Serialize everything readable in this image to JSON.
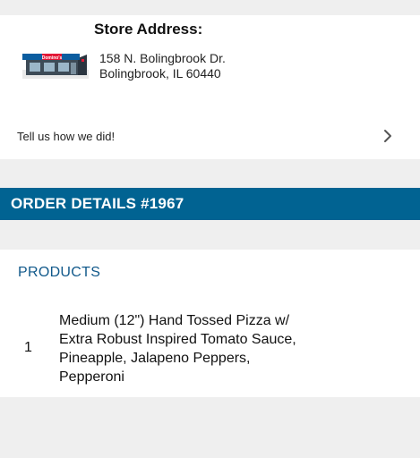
{
  "store": {
    "title": "Store Address:",
    "address_line1": "158 N. Bolingbrook Dr.",
    "address_line2": "Bolingbrook, IL 60440",
    "image_icon": "dominos-storefront-icon",
    "image_sign_text": "Domino's"
  },
  "feedback": {
    "label": "Tell us how we did!",
    "icon": "chevron-right-icon"
  },
  "order": {
    "title": "ORDER DETAILS #1967"
  },
  "products": {
    "label": "PRODUCTS",
    "items": [
      {
        "quantity": "1",
        "description": "Medium (12\") Hand Tossed Pizza w/ Extra Robust Inspired Tomato Sauce, Pineapple, Jalapeno Peppers, Pepperoni"
      }
    ]
  },
  "colors": {
    "page_background": "#efefef",
    "card_background": "#ffffff",
    "order_header_background": "#016392",
    "products_label": "#10588a"
  }
}
